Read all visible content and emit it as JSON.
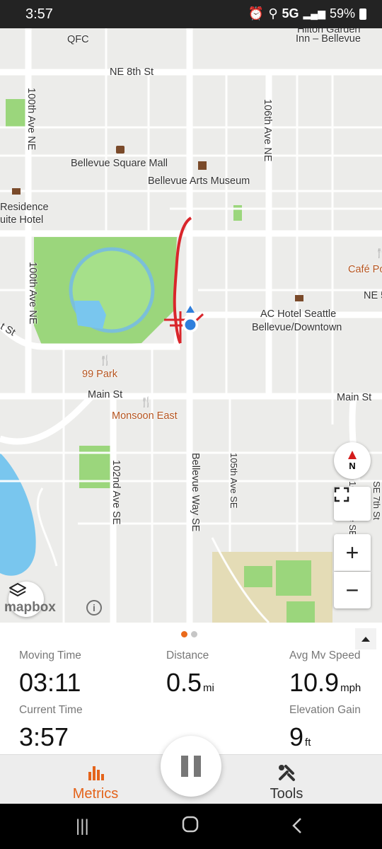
{
  "status_bar": {
    "time": "3:57",
    "network": "5G",
    "battery": "59%"
  },
  "map": {
    "labels": {
      "qfc": "QFC",
      "hilton": "Hilton Garden",
      "hilton2": "Inn – Bellevue",
      "ne8th": "NE 8th St",
      "ave100_top": "100th Ave NE",
      "ave100_mid": "100th Ave NE",
      "ave106": "106th Ave NE",
      "mall": "Bellevue Square Mall",
      "museum": "Bellevue Arts Museum",
      "residence1": "Residence",
      "residence2": "uite Hotel",
      "cafe": "Café Po",
      "ne_right": "NE 5",
      "ac_hotel1": "AC Hotel Seattle",
      "ac_hotel2": "Bellevue/Downtown",
      "st_left": "t St",
      "park99": "99 Park",
      "main_st_left": "Main St",
      "main_st_right": "Main St",
      "monsoon": "Monsoon East",
      "ave102": "102nd Ave SE",
      "bellevue_way": "Bellevue Way SE",
      "ave105": "105th Ave SE",
      "ave_right": "108th Ave SE",
      "ave_far_right": "SE 7th St"
    },
    "compass_label": "N",
    "zoom_in": "+",
    "zoom_out": "−",
    "attribution": "mapbox",
    "info": "i"
  },
  "panel": {
    "metrics": [
      {
        "label": "Moving Time",
        "value": "03:11",
        "unit": ""
      },
      {
        "label": "Distance",
        "value": "0.5",
        "unit": "mi"
      },
      {
        "label": "Avg Mv Speed",
        "value": "10.9",
        "unit": "mph"
      },
      {
        "label": "Current Time",
        "value": "3:57",
        "unit": ""
      },
      {
        "label": "Elevation Gain",
        "value": "9",
        "unit": "ft"
      }
    ],
    "page_dots": 2,
    "active_dot": 0
  },
  "tabs": {
    "metrics": "Metrics",
    "tools": "Tools"
  },
  "colors": {
    "accent": "#e4631a",
    "track": "#d9262b",
    "location": "#2f7fdc",
    "park": "#9bd67c",
    "water": "#79c6ee"
  }
}
